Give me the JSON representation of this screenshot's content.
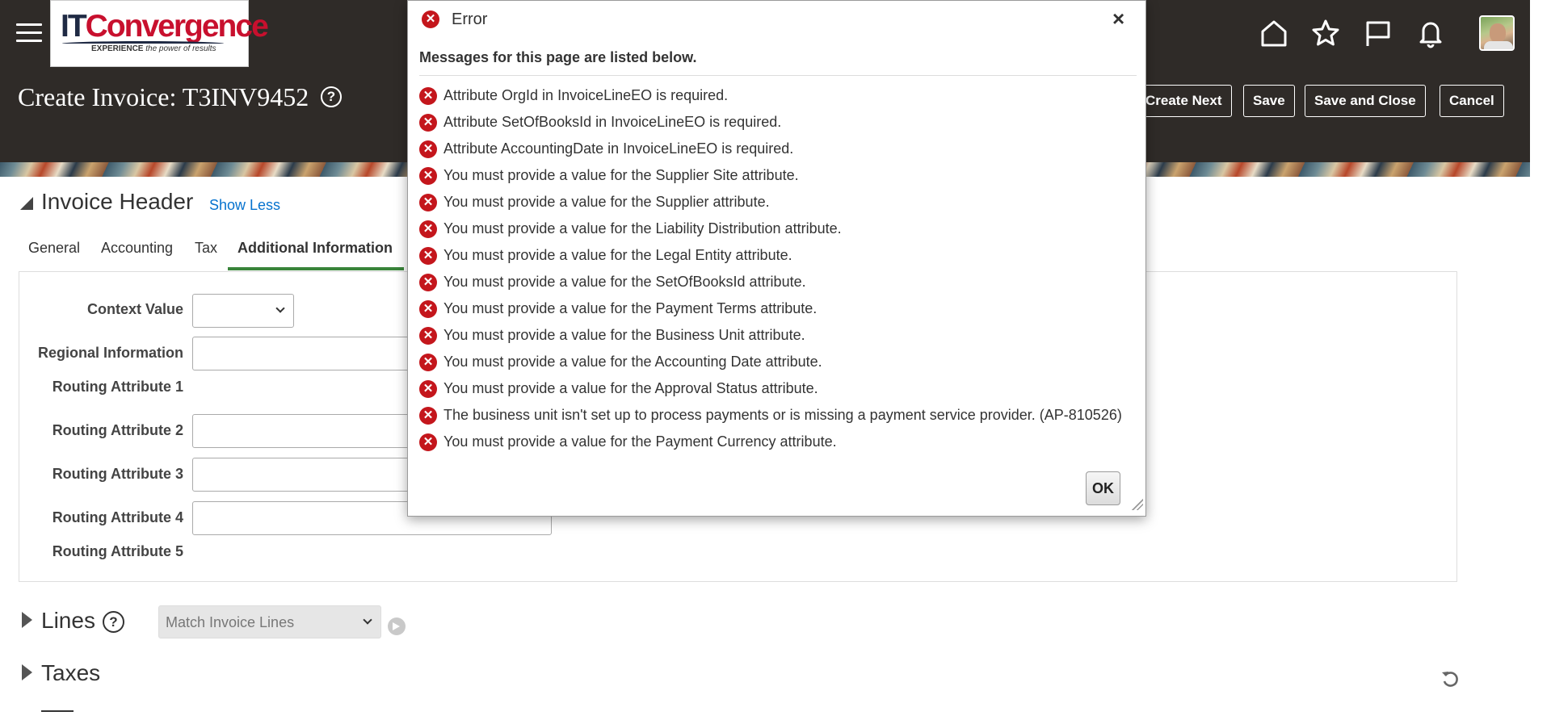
{
  "header": {
    "logo": {
      "it": "IT",
      "convergence": "Convergence",
      "tagline_bold": "EXPERIENCE",
      "tagline": "the power of results"
    },
    "page_title": "Create Invoice: T3INV9452",
    "help_glyph": "?",
    "icons": [
      "hamburger-icon",
      "home-icon",
      "star-icon",
      "flag-icon",
      "bell-icon"
    ],
    "buttons": {
      "create_next": "Create Next",
      "save": "Save",
      "save_and_close": "Save and Close",
      "cancel": "Cancel"
    }
  },
  "invoice_header": {
    "title": "Invoice Header",
    "show_less": "Show Less",
    "tabs": [
      {
        "label": "General",
        "active": false
      },
      {
        "label": "Accounting",
        "active": false
      },
      {
        "label": "Tax",
        "active": false
      },
      {
        "label": "Additional Information",
        "active": true
      }
    ],
    "fields": {
      "context_value": {
        "label": "Context Value",
        "value": ""
      },
      "regional_information": {
        "label": "Regional Information",
        "value": ""
      },
      "routing_attribute_1": {
        "label": "Routing Attribute 1"
      },
      "routing_attribute_2": {
        "label": "Routing Attribute 2",
        "value": ""
      },
      "routing_attribute_3": {
        "label": "Routing Attribute 3",
        "value": ""
      },
      "routing_attribute_4": {
        "label": "Routing Attribute 4",
        "value": ""
      },
      "routing_attribute_5": {
        "label": "Routing Attribute 5"
      }
    }
  },
  "lines": {
    "title": "Lines",
    "help_glyph": "?",
    "match_select": "Match Invoice Lines"
  },
  "taxes": {
    "title": "Taxes"
  },
  "dialog": {
    "title": "Error",
    "close_glyph": "×",
    "subtitle": "Messages for this page are listed below.",
    "messages": [
      "Attribute OrgId in InvoiceLineEO is required.",
      "Attribute SetOfBooksId in InvoiceLineEO is required.",
      "Attribute AccountingDate in InvoiceLineEO is required.",
      "You must provide a value for the Supplier Site attribute.",
      "You must provide a value for the Supplier attribute.",
      "You must provide a value for the Liability Distribution attribute.",
      "You must provide a value for the Legal Entity attribute.",
      "You must provide a value for the SetOfBooksId attribute.",
      "You must provide a value for the Payment Terms attribute.",
      "You must provide a value for the Business Unit attribute.",
      "You must provide a value for the Accounting Date attribute.",
      "You must provide a value for the Approval Status attribute.",
      "The business unit isn't set up to process payments or is missing a payment service provider. (AP-810526)",
      "You must provide a value for the Payment Currency attribute."
    ],
    "ok_label": "OK",
    "error_glyph": "✕"
  },
  "colors": {
    "header_bg": "#2f2b28",
    "link": "#0572ce",
    "active_tab_underline": "#39843a",
    "error_red": "#c4161c",
    "logo_red": "#c8102e",
    "logo_navy": "#1f2a44"
  }
}
